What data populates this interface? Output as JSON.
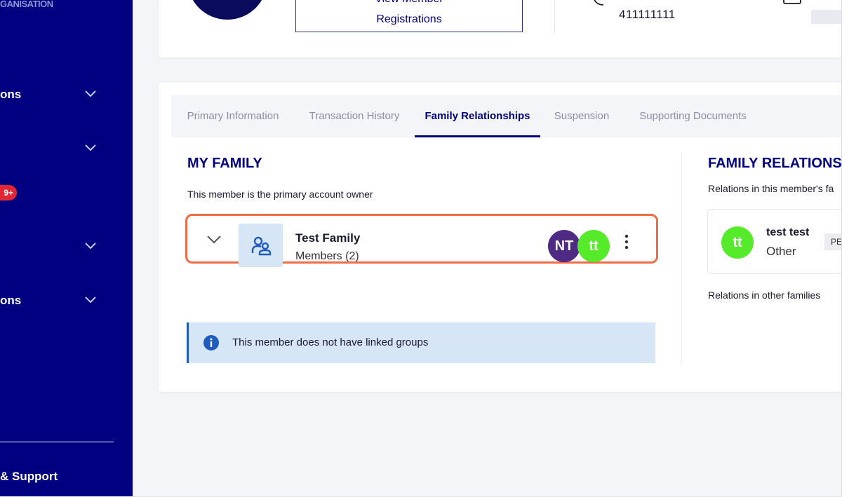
{
  "sidebar": {
    "org_label": "GANISATION",
    "items": [
      {
        "label": "ons"
      },
      {
        "label": ""
      },
      {
        "label": ""
      },
      {
        "label": "ons"
      }
    ],
    "badge": "9+",
    "support_label": "& Support"
  },
  "header": {
    "view_registrations_line1": "View Member",
    "view_registrations_line2": "Registrations",
    "phone": "411111111"
  },
  "tabs": [
    {
      "label": "Primary Information"
    },
    {
      "label": "Transaction History"
    },
    {
      "label": "Family Relationships"
    },
    {
      "label": "Suspension"
    },
    {
      "label": "Supporting Documents"
    }
  ],
  "my_family": {
    "title": "MY FAMILY",
    "note": "This member is the primary account owner",
    "family": {
      "name": "Test Family",
      "members": "Members (2)",
      "avatars": [
        "NT",
        "tt"
      ]
    },
    "info_banner": "This member does not have linked groups"
  },
  "relations": {
    "title": "FAMILY RELATIONS",
    "subtitle": "Relations in this member's fa",
    "card": {
      "initials": "tt",
      "name": "test test",
      "type": "Other",
      "badge": "PE"
    },
    "other_families": "Relations in other families"
  },
  "colors": {
    "sidebar_bg": "#000080",
    "brand_navy": "#000080",
    "highlight_orange": "#f06c42",
    "avatar_nt": "#4e2a84",
    "avatar_tt": "#55ea2a",
    "badge_red": "#e32636",
    "info_bg": "#d6e6f7"
  }
}
